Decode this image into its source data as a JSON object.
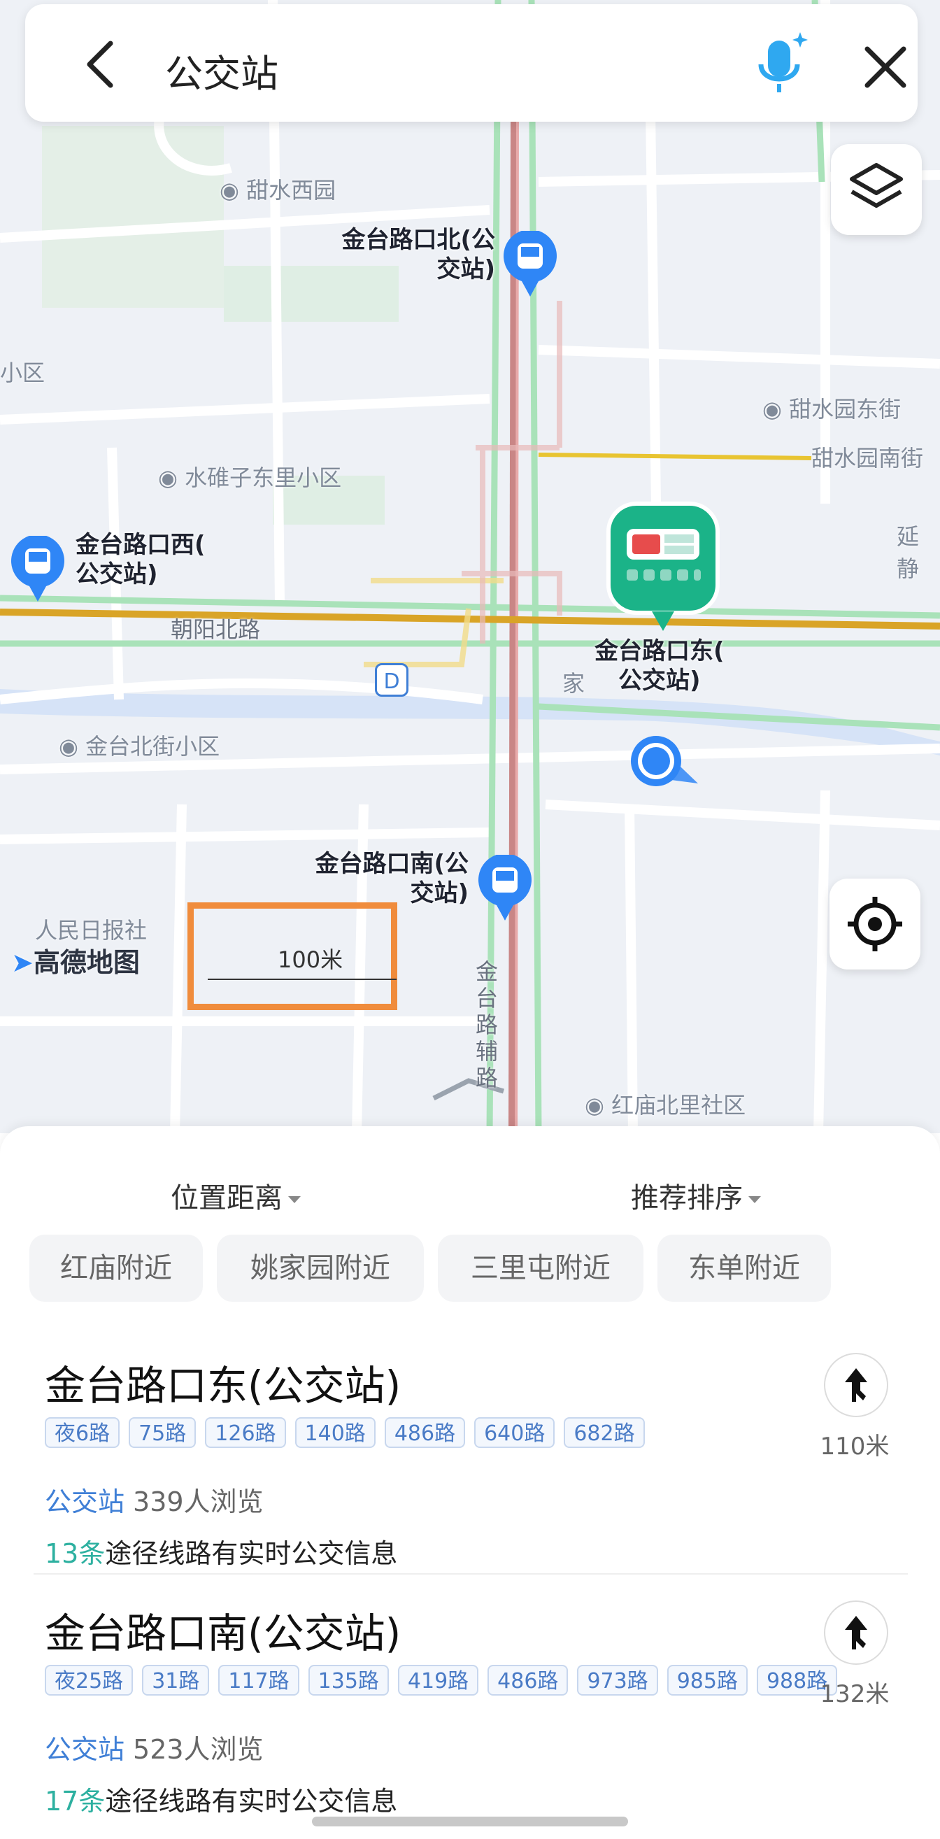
{
  "search": {
    "query": "公交站"
  },
  "map": {
    "labels": {
      "stop_north_line1": "金台路口北(公",
      "stop_north_line2": "交站)",
      "stop_west_line1": "金台路口西(",
      "stop_west_line2": "公交站)",
      "stop_east_line1": "金台路口东(",
      "stop_east_line2": "公交站)",
      "stop_south_line1": "金台路口南(公",
      "stop_south_line2": "交站)"
    },
    "pois": {
      "tianshui_west": "甜水西园",
      "tianshui_east": "甜水园东街",
      "tianshui_south": "甜水园南街",
      "shuiduizi": "水碓子东里小区",
      "jintai_north": "金台北街小区",
      "people_daily": "人民日报社",
      "honmiao_north": "红庙北里社区",
      "small_district": "小区",
      "yan": "延静",
      "jia": "家"
    },
    "roads": {
      "chaoyang_north": "朝阳北路",
      "jintai_aux": "金台路辅路"
    },
    "metro_letter": "D",
    "brand": "高德地图",
    "scale": "100米"
  },
  "filters": {
    "location": "位置距离",
    "sort": "推荐排序",
    "chips": [
      "红庙附近",
      "姚家园附近",
      "三里屯附近",
      "东单附近"
    ]
  },
  "results": [
    {
      "name": "金台路口东(公交站)",
      "routes": [
        "夜6路",
        "75路",
        "126路",
        "140路",
        "486路",
        "640路",
        "682路"
      ],
      "category": "公交站",
      "views": "339人浏览",
      "lines_count": "13条",
      "lines_note": "途径线路有实时公交信息",
      "distance": "110米"
    },
    {
      "name": "金台路口南(公交站)",
      "routes": [
        "夜25路",
        "31路",
        "117路",
        "135路",
        "419路",
        "486路",
        "973路",
        "985路",
        "988路"
      ],
      "category": "公交站",
      "views": "523人浏览",
      "lines_count": "17条",
      "lines_note": "途径线路有实时公交信息",
      "distance": "132米"
    }
  ],
  "colors": {
    "accent_blue": "#2f86f6",
    "bus_marker": "#2f86f6",
    "selected_marker": "#1bb388",
    "metro_yellow": "#e8c431",
    "main_road_gold": "#d9a427",
    "road_green": "#a9e2b9",
    "scale_box": "#f08c3c"
  }
}
